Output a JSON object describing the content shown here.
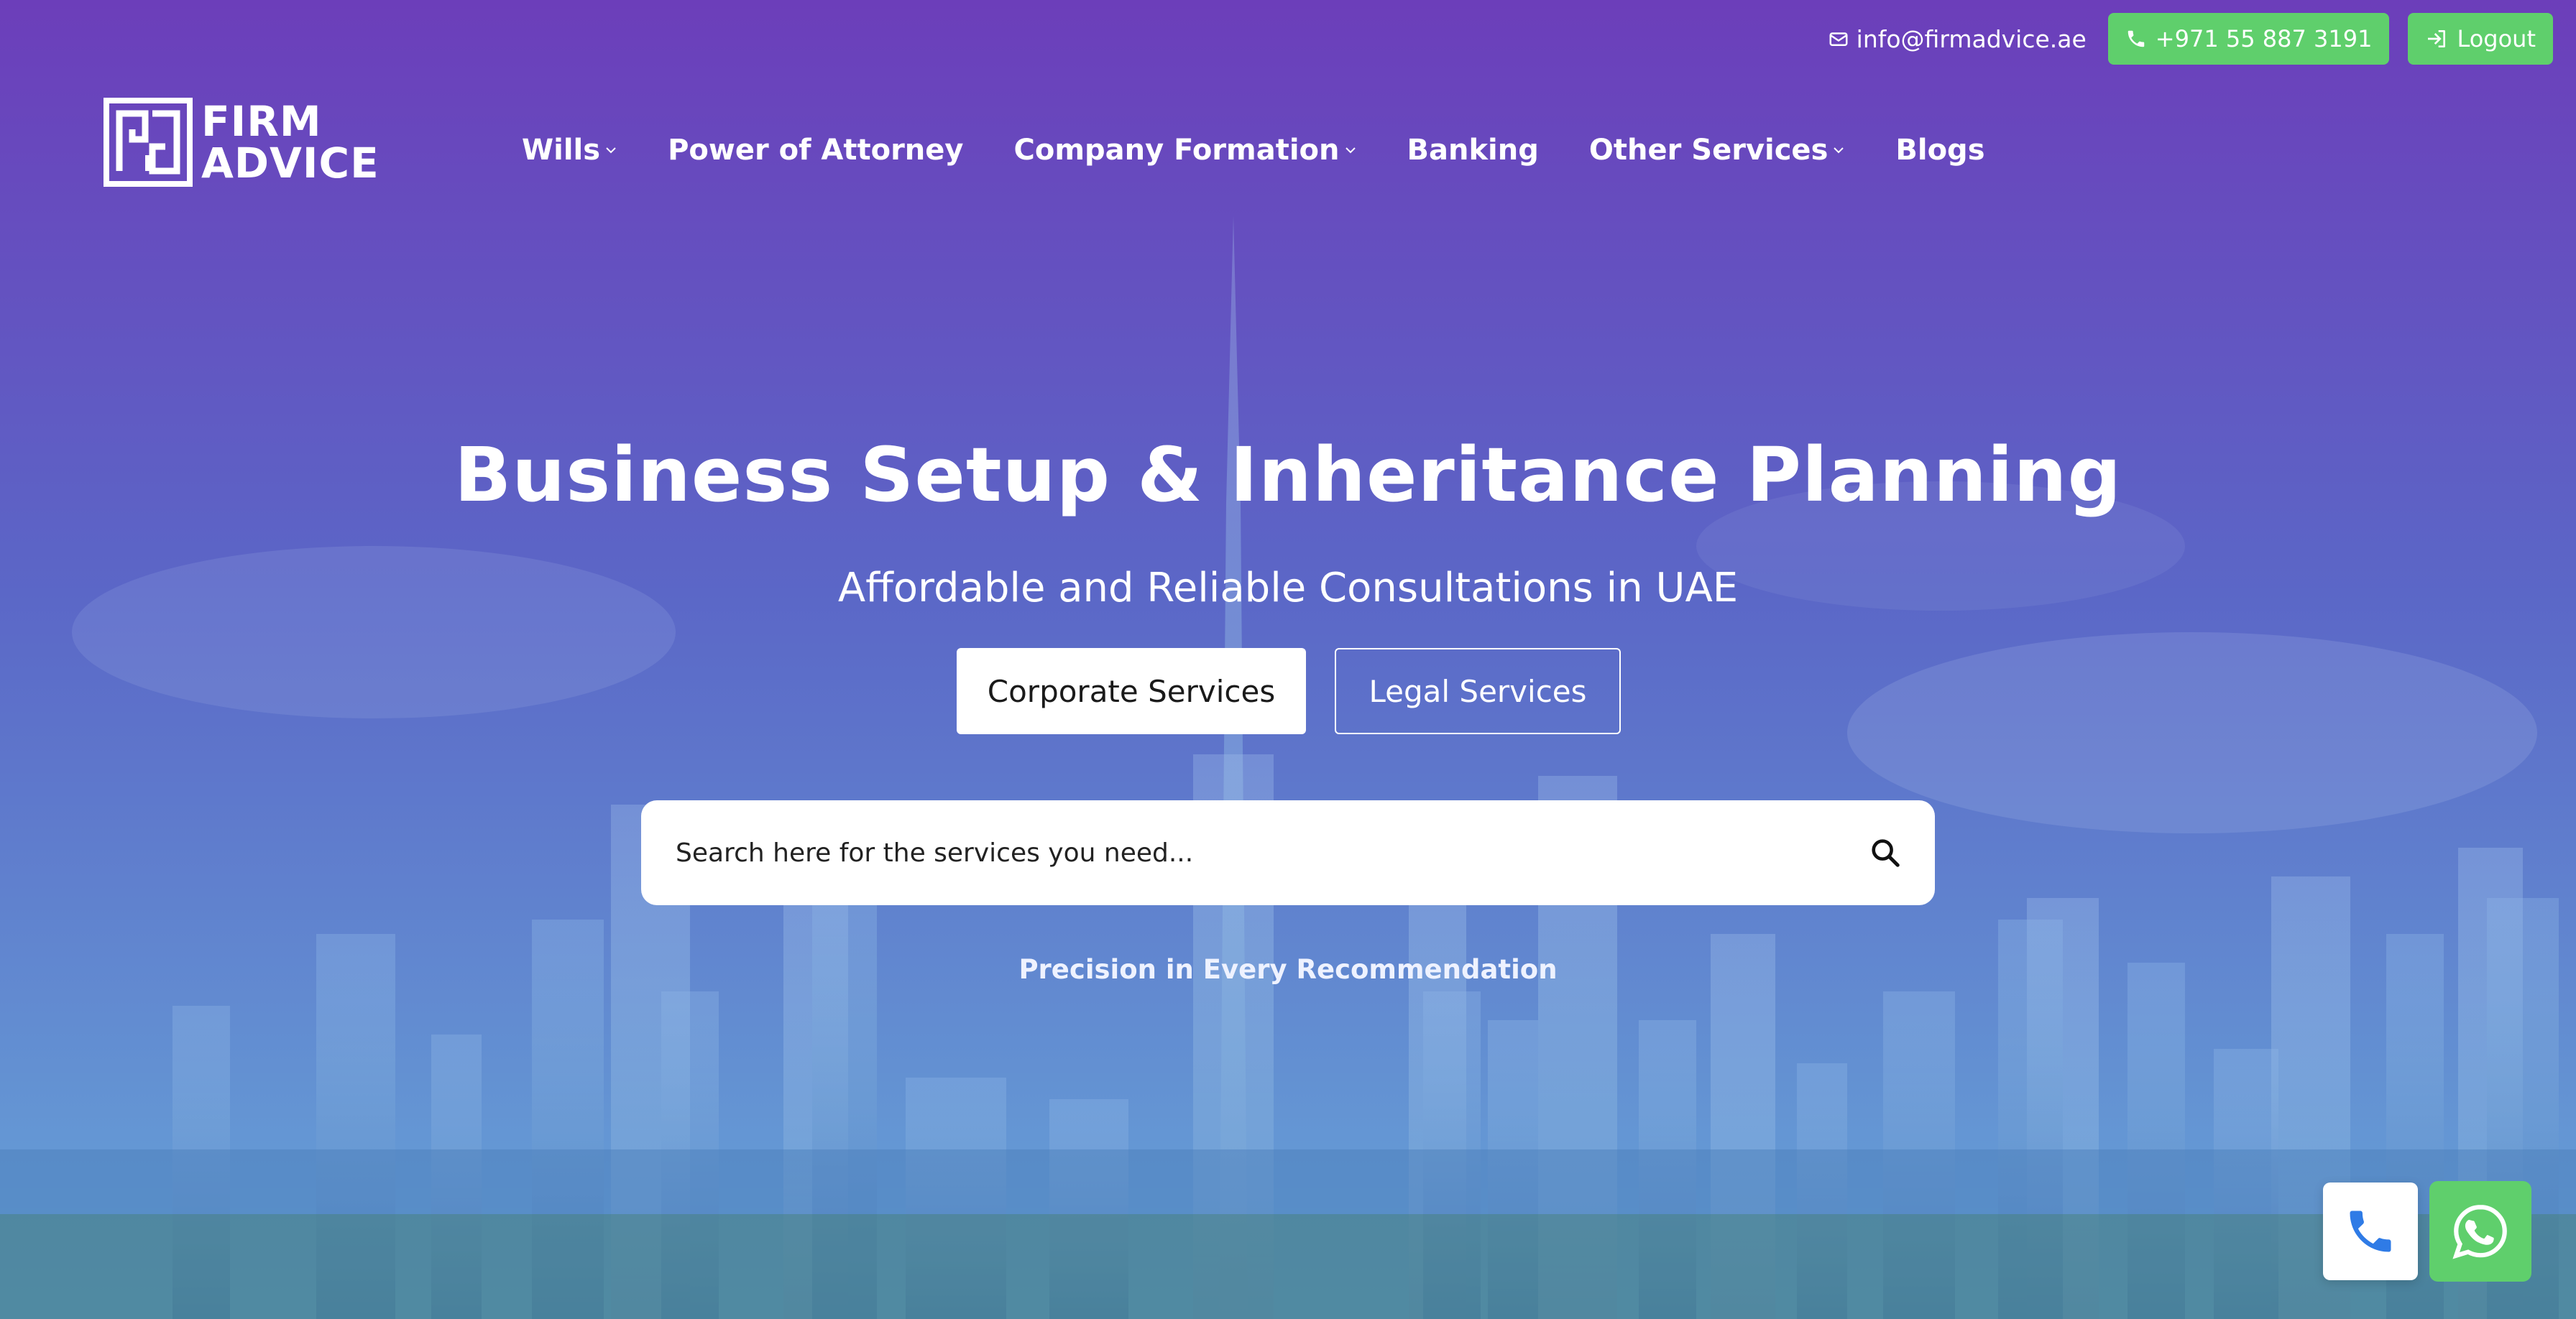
{
  "topbar": {
    "email": "info@firmadvice.ae",
    "phone": "+971 55 887 3191",
    "logout": "Logout"
  },
  "logo": {
    "line1": "FIRM",
    "line2": "ADVICE"
  },
  "nav": {
    "items": [
      {
        "label": "Wills",
        "has_dropdown": true
      },
      {
        "label": "Power of Attorney",
        "has_dropdown": false
      },
      {
        "label": "Company Formation",
        "has_dropdown": true
      },
      {
        "label": "Banking",
        "has_dropdown": false
      },
      {
        "label": "Other Services",
        "has_dropdown": true
      },
      {
        "label": "Blogs",
        "has_dropdown": false
      }
    ]
  },
  "hero": {
    "title": "Business Setup & Inheritance Planning",
    "subtitle": "Affordable and Reliable Consultations in UAE",
    "primary_cta": "Corporate Services",
    "secondary_cta": "Legal Services",
    "tagline": "Precision in Every Recommendation"
  },
  "search": {
    "placeholder": "Search here for the services you need..."
  },
  "colors": {
    "gradient_top": "#6c3fba",
    "gradient_mid": "#5a6cc8",
    "gradient_bottom": "#5f9fd6",
    "green": "#5fcf6c",
    "white": "#ffffff"
  },
  "icons": {
    "email": "envelope-icon",
    "phone": "phone-icon",
    "logout": "sign-in-icon",
    "search": "search-icon",
    "call_fab": "phone-icon",
    "whatsapp_fab": "whatsapp-icon"
  }
}
